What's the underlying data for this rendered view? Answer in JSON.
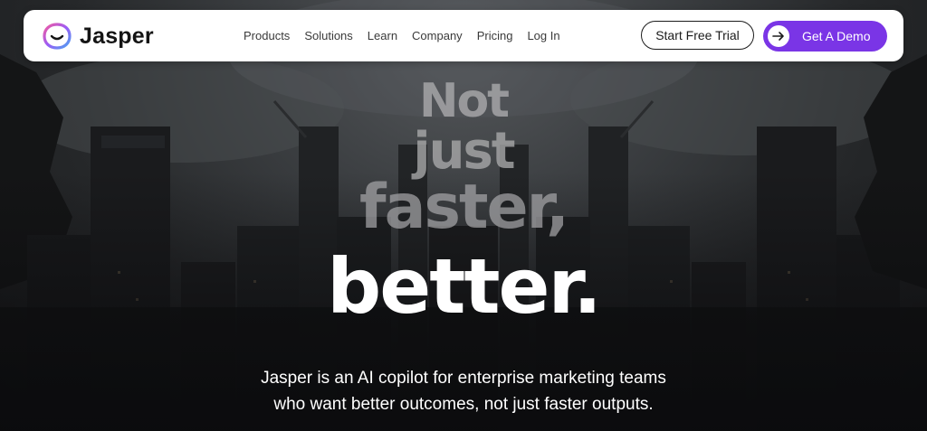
{
  "brand": {
    "name": "Jasper"
  },
  "nav": {
    "links": [
      "Products",
      "Solutions",
      "Learn",
      "Company",
      "Pricing",
      "Log In"
    ]
  },
  "actions": {
    "trial_label": "Start Free Trial",
    "demo_label": "Get A Demo",
    "demo_icon": "arrow-right-icon"
  },
  "hero": {
    "headline": {
      "line1": "Not",
      "line2": "just",
      "line3": "faster,",
      "line4": "better."
    },
    "subtext": {
      "line1": "Jasper is an AI copilot for enterprise marketing teams",
      "line2": "who want better outcomes, not just faster outputs."
    }
  },
  "colors": {
    "accent": "#7a35e6",
    "navbar_bg": "#ffffff",
    "text_dark": "#141414"
  }
}
